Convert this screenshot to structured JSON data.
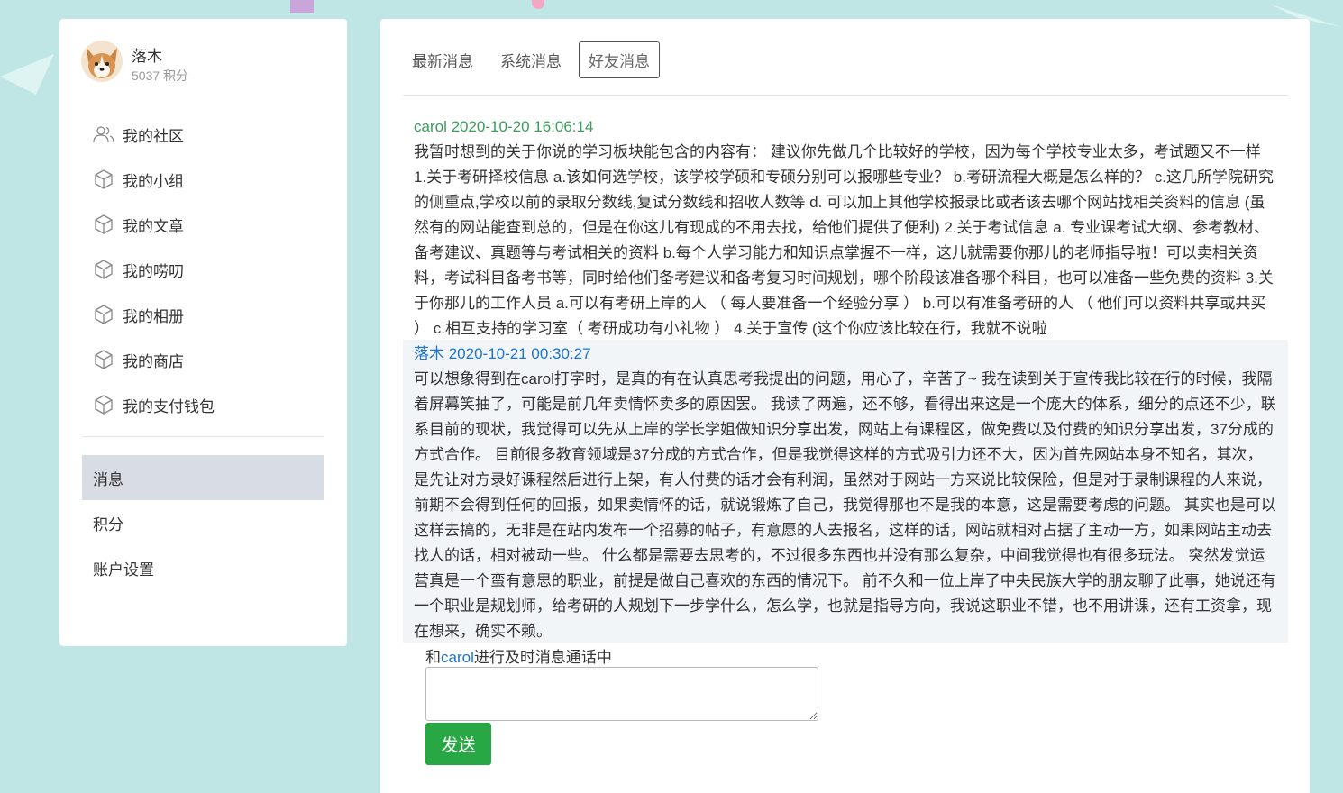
{
  "colors": {
    "background": "#bfe6e4",
    "panel": "#ffffff",
    "active_menu": "#d8dde3",
    "friend_name": "#3a9c5b",
    "self_name": "#1e74c8",
    "send_button": "#28a745"
  },
  "profile": {
    "name": "落木",
    "points": "5037 积分",
    "avatar_icon": "corgi-avatar"
  },
  "menu": [
    {
      "label": "我的社区",
      "icon": "users-icon"
    },
    {
      "label": "我的小组",
      "icon": "cube-icon"
    },
    {
      "label": "我的文章",
      "icon": "cube-icon"
    },
    {
      "label": "我的唠叨",
      "icon": "cube-icon"
    },
    {
      "label": "我的相册",
      "icon": "cube-icon"
    },
    {
      "label": "我的商店",
      "icon": "cube-icon"
    },
    {
      "label": "我的支付钱包",
      "icon": "cube-icon"
    }
  ],
  "sub_menu": [
    {
      "label": "消息",
      "active": true
    },
    {
      "label": "积分",
      "active": false
    },
    {
      "label": "账户设置",
      "active": false
    }
  ],
  "tabs": [
    {
      "label": "最新消息",
      "active": false
    },
    {
      "label": "系统消息",
      "active": false
    },
    {
      "label": "好友消息",
      "active": true
    }
  ],
  "messages": [
    {
      "header": "carol 2020-10-20 16:06:14",
      "body": "我暂时想到的关于你说的学习板块能包含的内容有： 建议你先做几个比较好的学校，因为每个学校专业太多，考试题又不一样 1.关于考研择校信息 a.该如何选学校，该学校学硕和专硕分别可以报哪些专业？ b.考研流程大概是怎么样的？ c.这几所学院研究的侧重点,学校以前的录取分数线,复试分数线和招收人数等 d. 可以加上其他学校报录比或者该去哪个网站找相关资料的信息 (虽然有的网站能查到总的，但是在你这儿有现成的不用去找，给他们提供了便利) 2.关于考试信息 a. 专业课考试大纲、参考教材、备考建议、真题等与考试相关的资料 b.每个人学习能力和知识点掌握不一样，这儿就需要你那儿的老师指导啦！可以卖相关资料，考试科目备考书等，同时给他们备考建议和备考复习时间规划，哪个阶段该准备哪个科目，也可以准备一些免费的资料 3.关于你那儿的工作人员 a.可以有考研上岸的人 （ 每人要准备一个经验分享 ） b.可以有准备考研的人 （ 他们可以资料共享或共买 ） c.相互支持的学习室（ 考研成功有小礼物 ） 4.关于宣传 (这个你应该比较在行，我就不说啦"
    },
    {
      "header": "落木 2020-10-21 00:30:27",
      "body": "可以想象得到在carol打字时，是真的有在认真思考我提出的问题，用心了，辛苦了~ 我在读到关于宣传我比较在行的时候，我隔着屏幕笑抽了，可能是前几年卖情怀卖多的原因罢。 我读了两遍，还不够，看得出来这是一个庞大的体系，细分的点还不少，联系目前的现状，我觉得可以先从上岸的学长学姐做知识分享出发，网站上有课程区，做免费以及付费的知识分享出发，37分成的方式合作。 目前很多教育领域是37分成的方式合作，但是我觉得这样的方式吸引力还不大，因为首先网站本身不知名，其次，是先让对方录好课程然后进行上架，有人付费的话才会有利润，虽然对于网站一方来说比较保险，但是对于录制课程的人来说，前期不会得到任何的回报，如果卖情怀的话，就说锻炼了自己，我觉得那也不是我的本意，这是需要考虑的问题。 其实也是可以这样去搞的，无非是在站内发布一个招募的帖子，有意愿的人去报名，这样的话，网站就相对占据了主动一方，如果网站主动去找人的话，相对被动一些。 什么都是需要去思考的，不过很多东西也并没有那么复杂，中间我觉得也有很多玩法。 突然发觉运营真是一个蛮有意思的职业，前提是做自己喜欢的东西的情况下。 前不久和一位上岸了中央民族大学的朋友聊了此事，她说还有一个职业是规划师，给考研的人规划下一步学什么，怎么学，也就是指导方向，我说这职业不错，也不用讲课，还有工资拿，现在想来，确实不赖。"
    }
  ],
  "chat": {
    "prefix": "和",
    "peer": "carol",
    "suffix": "进行及时消息通话中",
    "input_value": "",
    "send_label": "发送"
  }
}
